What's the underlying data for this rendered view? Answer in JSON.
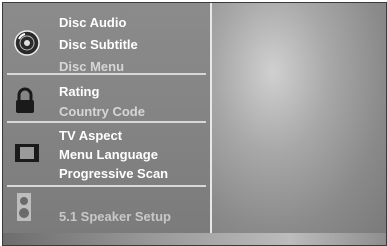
{
  "menu": {
    "disc": {
      "icon": "disc-icon",
      "items": [
        "Disc Audio",
        "Disc Subtitle",
        "Disc Menu"
      ]
    },
    "lock": {
      "icon": "padlock-icon",
      "items": [
        "Rating",
        "Country Code"
      ]
    },
    "display": {
      "icon": "tv-screen-icon",
      "items": [
        "TV Aspect",
        "Menu Language",
        "Progressive Scan"
      ]
    },
    "audio": {
      "icon": "speaker-icon",
      "items": [
        "5.1 Speaker Setup"
      ]
    }
  }
}
